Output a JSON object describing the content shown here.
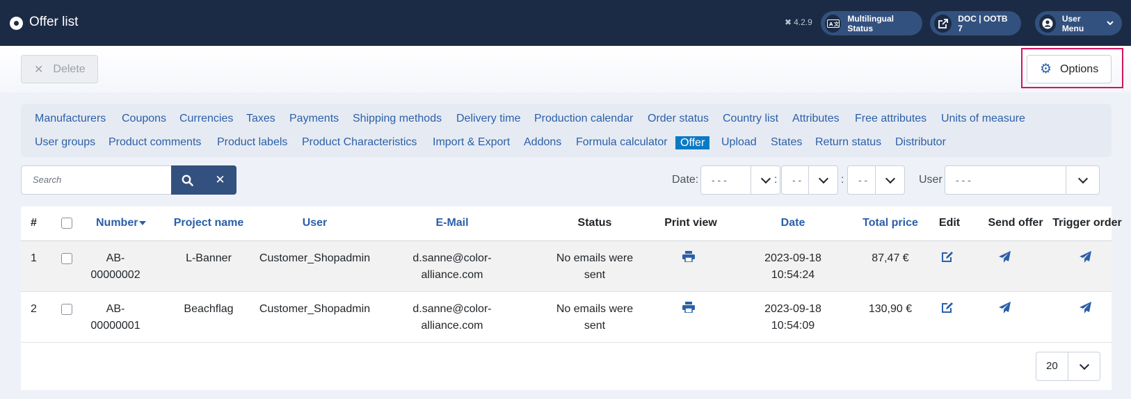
{
  "header": {
    "title": "Offer list",
    "version": "4.2.9",
    "multilingual_label": "Multilingual Status",
    "multilingual_icon_text": "A 文",
    "doc_label": "DOC | OOTB 7",
    "user_menu_label": "User Menu"
  },
  "toolbar": {
    "delete_label": "Delete",
    "options_label": "Options"
  },
  "nav": {
    "row1": [
      "Manufacturers",
      "Coupons",
      "Currencies",
      "Taxes",
      "Payments",
      "Shipping methods",
      "Delivery time",
      "Production calendar",
      "Order status",
      "Country list",
      "Attributes",
      "Free attributes",
      "Units of measure"
    ],
    "row2": [
      "User groups",
      "Product comments",
      "Product labels",
      "Product Characteristics",
      "Import & Export",
      "Addons",
      "Formula calculator",
      "Offer",
      "Upload",
      "States",
      "Return status",
      "Distributor"
    ],
    "active": "Offer"
  },
  "filters": {
    "search_placeholder": "Search",
    "date_label": "Date:",
    "date_sep": ":",
    "date_day": "- - -",
    "date_month": "- -",
    "date_year": "- -",
    "user_label": "User",
    "user_value": "- - -"
  },
  "table": {
    "headers": {
      "num": "#",
      "number": "Number",
      "project": "Project name",
      "user": "User",
      "email": "E-Mail",
      "status": "Status",
      "print": "Print view",
      "date": "Date",
      "total": "Total price",
      "edit": "Edit",
      "send": "Send offer",
      "trigger": "Trigger order"
    },
    "rows": [
      {
        "index": "1",
        "number_a": "AB-",
        "number_b": "00000002",
        "project": "L-Banner",
        "user": "Customer_Shopadmin",
        "email_a": "d.sanne@color-",
        "email_b": "alliance.com",
        "status_a": "No emails were",
        "status_b": "sent",
        "date_a": "2023-09-18",
        "date_b": "10:54:24",
        "total": "87,47 €"
      },
      {
        "index": "2",
        "number_a": "AB-",
        "number_b": "00000001",
        "project": "Beachflag",
        "user": "Customer_Shopadmin",
        "email_a": "d.sanne@color-",
        "email_b": "alliance.com",
        "status_a": "No emails were",
        "status_b": "sent",
        "date_a": "2023-09-18",
        "date_b": "10:54:09",
        "total": "130,90 €"
      }
    ]
  },
  "pagination": {
    "page_size": "20"
  },
  "colors": {
    "header_bg": "#1c2b45",
    "accent": "#2b5fa8",
    "active_tab": "#0b7ac4",
    "highlight": "#d0155f"
  },
  "icons": [
    "joomla-icon",
    "translate-icon",
    "external-link-icon",
    "user-circle-icon",
    "chevron-down-icon",
    "close-icon",
    "gear-icon",
    "search-icon",
    "print-icon",
    "edit-icon",
    "send-icon",
    "sort-desc-icon"
  ]
}
